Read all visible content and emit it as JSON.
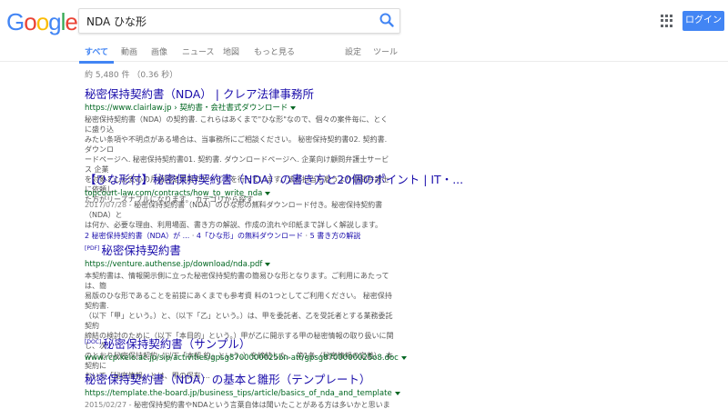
{
  "logo": {
    "letters": [
      "G",
      "o",
      "o",
      "g",
      "l",
      "e"
    ],
    "colors": [
      "#4285f4",
      "#ea4335",
      "#fbbc05",
      "#4285f4",
      "#34a853",
      "#ea4335"
    ]
  },
  "search": {
    "query": "NDA ひな形",
    "icon": "search-icon",
    "accent": "#4285f4"
  },
  "header": {
    "apps_icon": "apps-grid-icon",
    "login_label": "ログイン"
  },
  "tabs": {
    "all": "すべて",
    "video": "動画",
    "images": "画像",
    "news": "ニュース",
    "maps": "地図",
    "more": "もっと見る",
    "settings": "設定",
    "tools": "ツール"
  },
  "stats": "約 5,480 件 （0.36 秒）",
  "results": [
    {
      "title": "秘密保持契約書（NDA） | クレア法律事務所",
      "url": "https://www.clairlaw.jp › 契約書・会社書式ダウンロード",
      "snippet": [
        "秘密保持契約書（NDA）の契約書. これらはあくまで\"ひな形\"なので、個々の案件毎に、とくに盛り込",
        "みたい条項や不明点がある場合は、当事務所にご相談ください。 秘密保持契約書02. 契約書. ダウンロ",
        "ードページへ. 秘密保持契約書01. 契約書. ダウンロードページへ. 企業向け顧問弁護士サービス 企業",
        "を対象とした安心の月額固定費用のサービスを行っています。法務担当を雇うより顧問弁護士に依頼し",
        "た方がリーズナブルになります。 カテゴリから探す ..."
      ]
    },
    {
      "title": "【ひな形付】秘密保持契約書（NDA）の書き方と20個のポイント | IT・...",
      "url": "topcourt-law.com/contracts/how_to_write_nda",
      "date": "2017/07/28 - ",
      "snippet": [
        "秘密保持契約書（NDA）のひな形の無料ダウンロード付き。秘密保持契約書（NDA）と",
        "は何か、必要な理由、利用場面、書き方の解説、作成の流れや印紙まで詳しく解説します。"
      ],
      "links": [
        "2 秘密保持契約書（NDA）が ...",
        "4「ひな形」の無料ダウンロード",
        "5 書き方の解説"
      ]
    },
    {
      "badge": "[PDF]",
      "title": "秘密保持契約書",
      "url": "https://venture.authense.jp/download/nda.pdf",
      "snippet": [
        "本契約書は、情報開示側に立った秘密保持契約書の簡易ひな形となります。ご利用にあたっては、簡",
        "易版のひな形であることを前提にあくまでも参考資 料の1つとしてご利用ください。 秘密保持契約書.",
        "（以下「甲」という。）と、（以下「乙」という。）は、甲を委託者、乙を受託者とする業務委託契約",
        "締結の検討のために（以下「本目的」という。）甲が乙に開示する甲の秘密情報の取り扱いに関し、次",
        "のとおり秘密保持契約（以下「本契 約」という。）を締結した。 第1条（秘密情報の定義）. 本契約に",
        "おいて「秘密情報」とは、甲の保有 ..."
      ]
    },
    {
      "badge": "[DOC]",
      "title": "秘密保持契約書（サンプル）",
      "url": "www.rcp.keio.ac.jp/sip/activities/gpsg8700000025bn-att/gpsg8700000025o8.doc"
    },
    {
      "title": "秘密保持契約書（NDA）の基本と雛形（テンプレート）",
      "url": "https://template.the-board.jp/business_tips/article/basics_of_nda_and_template",
      "date": "2015/02/27 - ",
      "snippet": [
        "秘密保持契約書やNDAという言葉自体は聞いたことがある方は多いかと思いますが、 自"
      ]
    }
  ]
}
